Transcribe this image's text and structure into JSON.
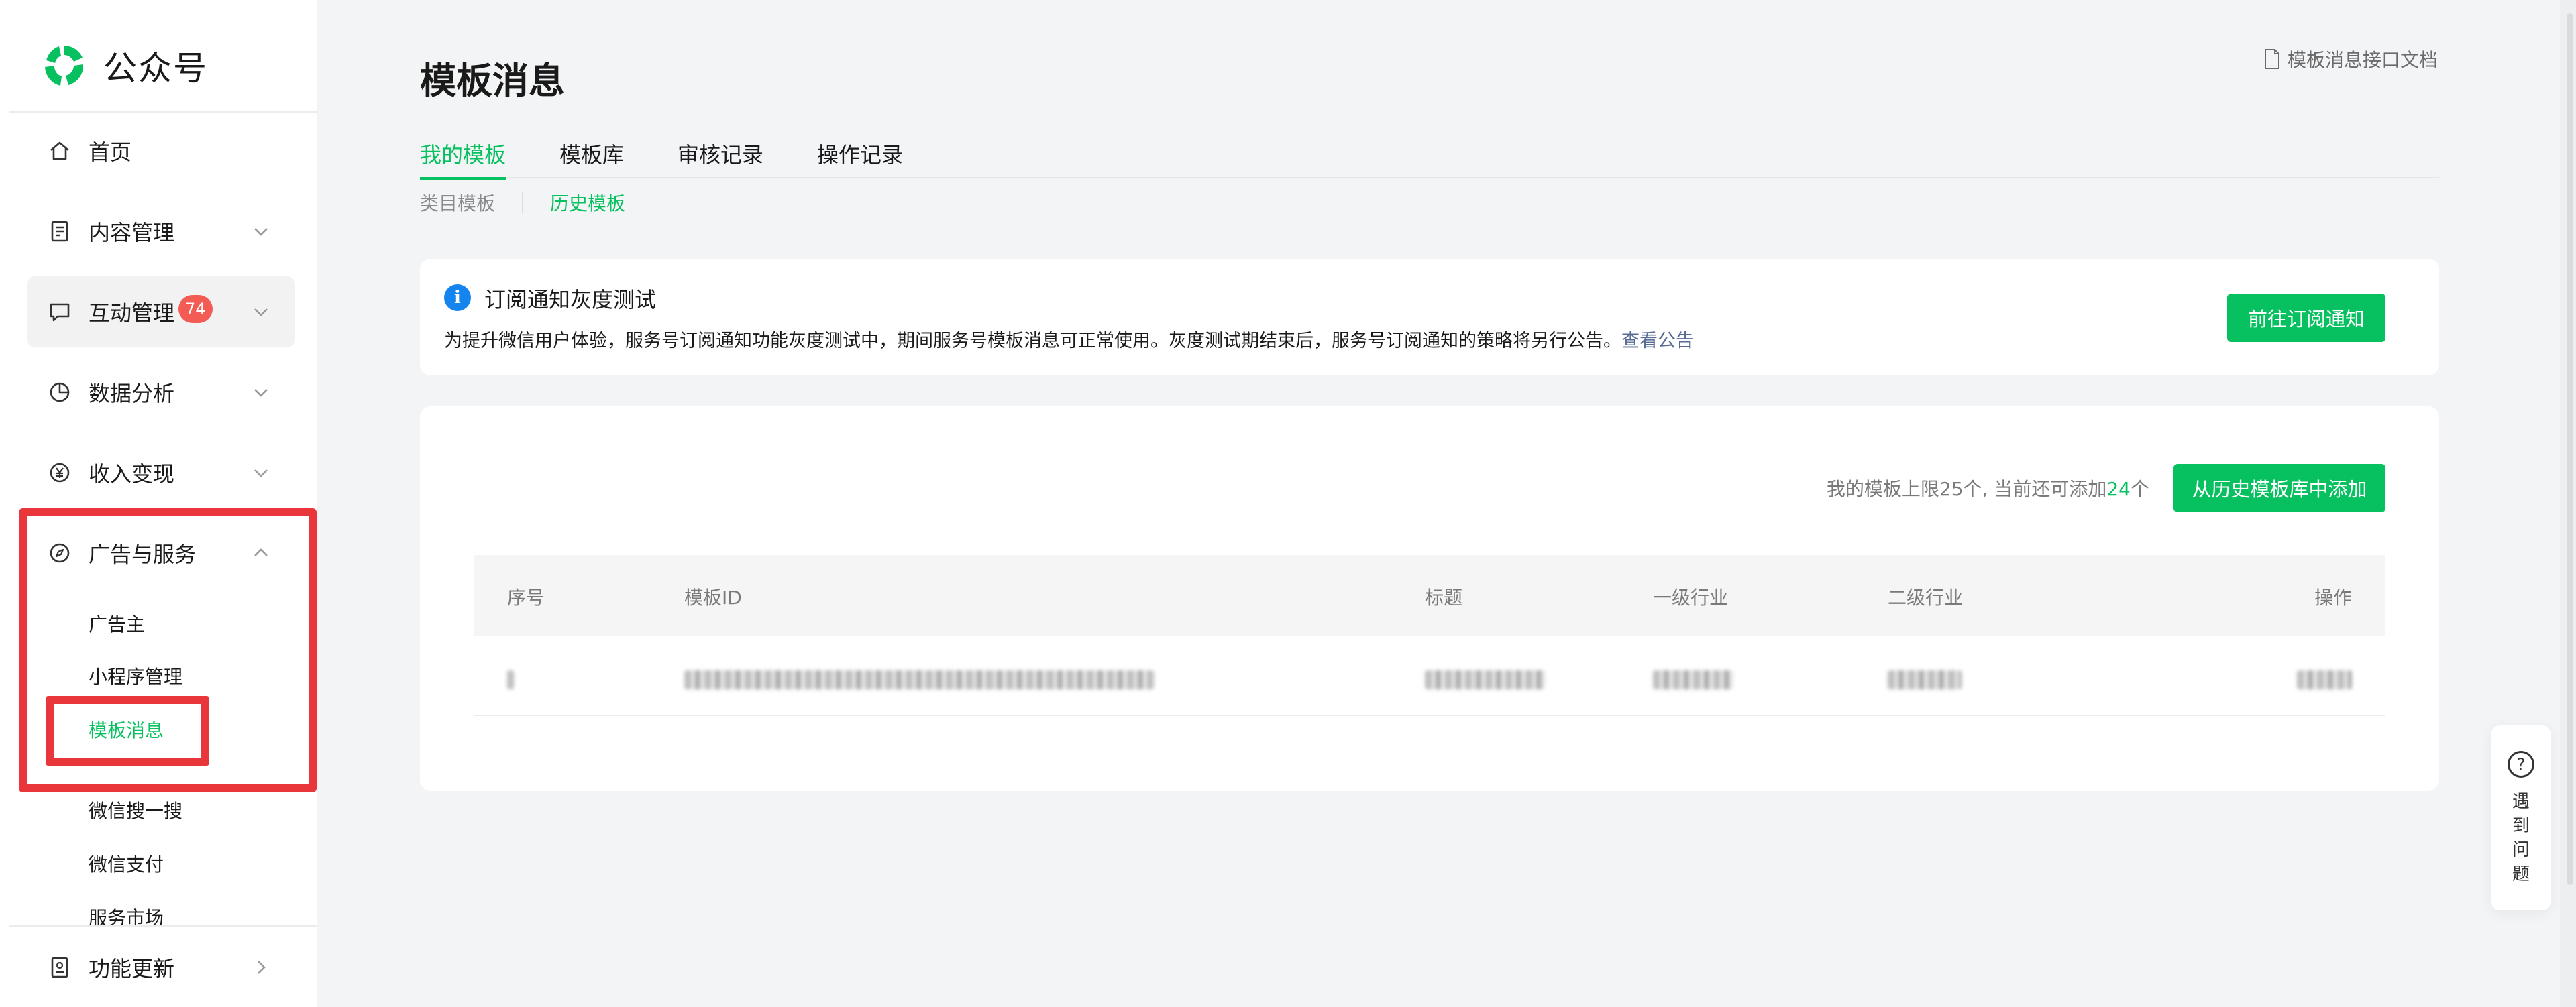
{
  "brand": {
    "name": "公众号",
    "color": "#07c160"
  },
  "sidebar": {
    "items": [
      {
        "label": "首页",
        "icon": "home-icon"
      },
      {
        "label": "内容管理",
        "icon": "document-icon",
        "chevron": "down"
      },
      {
        "label": "互动管理",
        "icon": "chat-bubble-icon",
        "badge": "74",
        "chevron": "down"
      },
      {
        "label": "数据分析",
        "icon": "pie-chart-icon",
        "chevron": "down"
      },
      {
        "label": "收入变现",
        "icon": "yen-coin-icon",
        "chevron": "down"
      },
      {
        "label": "广告与服务",
        "icon": "compass-icon",
        "chevron": "up"
      }
    ],
    "sub_items": [
      "广告主",
      "小程序管理",
      "模板消息",
      "微信搜一搜",
      "微信支付",
      "服务市场"
    ],
    "active_sub": "模板消息",
    "bottom_item": {
      "label": "功能更新",
      "icon": "update-notebook-icon",
      "chevron": "right"
    }
  },
  "header": {
    "title": "模板消息",
    "doc_link": "模板消息接口文档"
  },
  "tabs": [
    "我的模板",
    "模板库",
    "审核记录",
    "操作记录"
  ],
  "subtabs": [
    "类目模板",
    "历史模板"
  ],
  "notice": {
    "title": "订阅通知灰度测试",
    "body": "为提升微信用户体验，服务号订阅通知功能灰度测试中，期间服务号模板消息可正常使用。灰度测试期结束后，服务号订阅通知的策略将另行公告。",
    "link": "查看公告",
    "button": "前往订阅通知"
  },
  "templates": {
    "limit_prefix": "我的模板上限25个, 当前还可添加",
    "limit_remaining": "24",
    "limit_suffix": "个",
    "add_button": "从历史模板库中添加",
    "columns": [
      "序号",
      "模板ID",
      "标题",
      "一级行业",
      "二级行业",
      "操作"
    ]
  },
  "help": {
    "label": "遇到问题"
  },
  "colors": {
    "accent": "#07c160",
    "link": "#576b95",
    "badge": "#f25c54",
    "highlight": "#e8363a",
    "info": "#1485ee"
  }
}
